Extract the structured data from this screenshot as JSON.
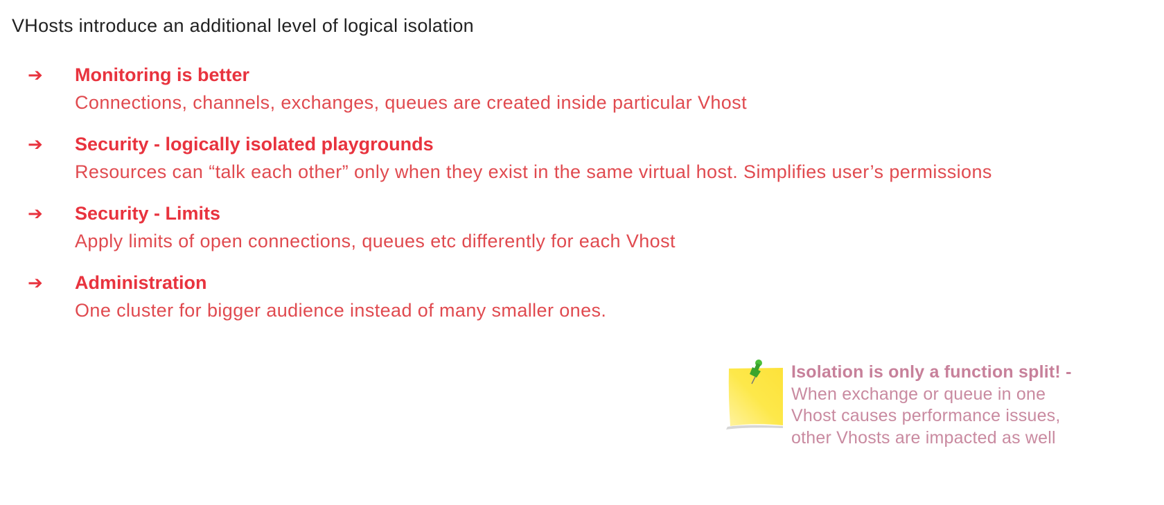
{
  "title": "VHosts introduce an additional level of logical isolation",
  "arrow_glyph": "➔",
  "items": [
    {
      "heading": "Monitoring is better",
      "description": "Connections, channels, exchanges, queues are created inside particular Vhost"
    },
    {
      "heading": "Security - logically isolated playgrounds",
      "description": "Resources can “talk each other” only when they exist in the same virtual host. Simplifies user’s permissions"
    },
    {
      "heading": "Security - Limits",
      "description": "Apply limits of open connections, queues etc differently for each Vhost"
    },
    {
      "heading": "Administration",
      "description": "One cluster for bigger audience instead of many smaller ones."
    }
  ],
  "note": {
    "icon": "sticky-note-pin-icon",
    "heading": "Isolation is only a function split! -",
    "lines": [
      "When exchange or queue in one",
      "Vhost causes performance issues,",
      "other Vhosts are impacted as well"
    ]
  },
  "colors": {
    "accent": "#e8333e",
    "note_text": "#c98aa0",
    "sticky": "#fde84a"
  }
}
